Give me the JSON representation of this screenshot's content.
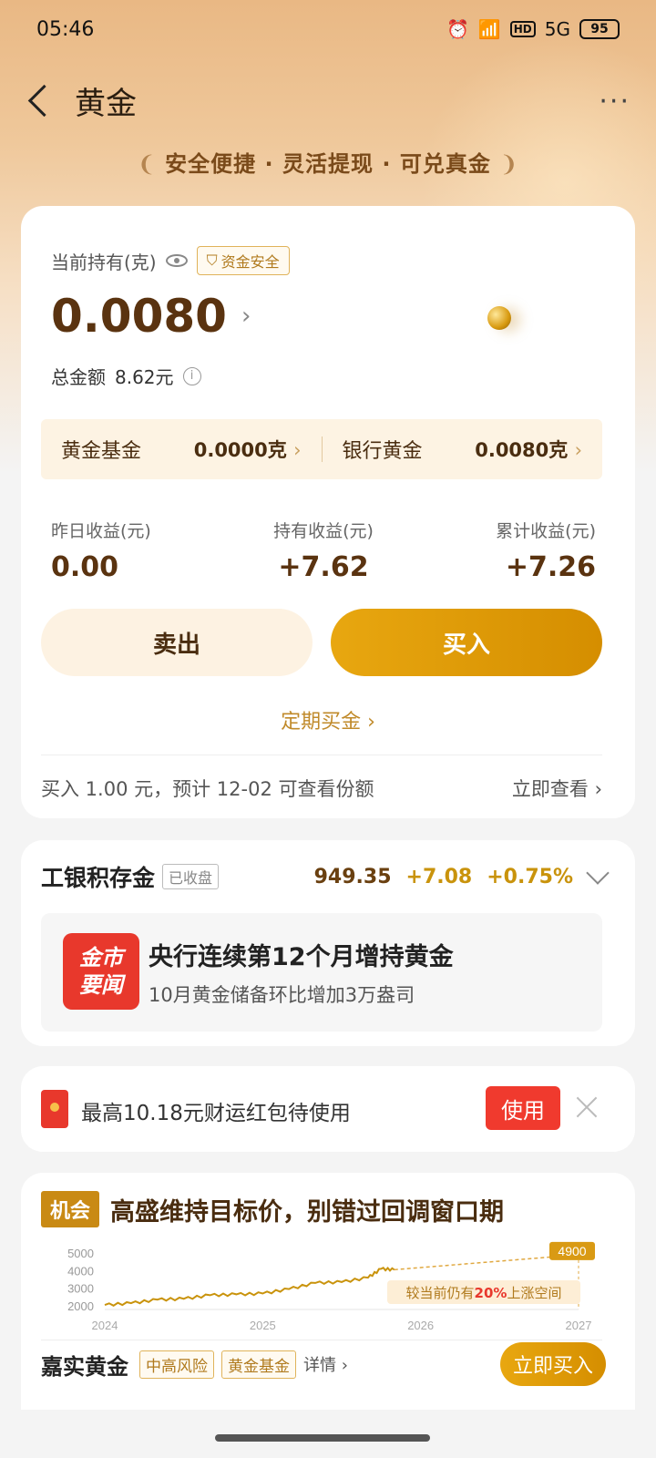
{
  "status_bar": {
    "time": "05:46",
    "battery": "95",
    "hd": "HD",
    "signal": "5G"
  },
  "header": {
    "title": "黄金",
    "more": "···"
  },
  "slogan": {
    "text": "安全便捷 · 灵活提现 · 可兑真金"
  },
  "holdings": {
    "label": "当前持有(克)",
    "safe_badge": "资金安全",
    "amount": "0.0080",
    "total_label": "总金额",
    "total_value": "8.62元",
    "split": [
      {
        "label": "黄金基金",
        "value": "0.0000克"
      },
      {
        "label": "银行黄金",
        "value": "0.0080克"
      }
    ],
    "earnings": [
      {
        "label": "昨日收益(元)",
        "value": "0.00"
      },
      {
        "label": "持有收益(元)",
        "value": "+7.62"
      },
      {
        "label": "累计收益(元)",
        "value": "+7.26"
      }
    ],
    "sell_label": "卖出",
    "buy_label": "买入",
    "periodic_label": "定期买金",
    "notice_text": "买入 1.00 元，预计 12-02 可查看份额",
    "notice_link": "立即查看"
  },
  "market": {
    "name": "工银积存金",
    "status": "已收盘",
    "price": "949.35",
    "change": "+7.08",
    "percent": "+0.75%",
    "news_logo_line1": "金市",
    "news_logo_line2": "要闻",
    "news_title": "央行连续第12个月增持黄金",
    "news_sub": "10月黄金储备环比增加3万盎司"
  },
  "redpack": {
    "text": "最高10.18元财运红包待使用",
    "use_label": "使用"
  },
  "opportunity": {
    "tag": "机会",
    "title": "高盛维持目标价，别错过回调窗口期",
    "fund_name": "嘉实黄金",
    "badge_risk": "中高风险",
    "badge_type": "黄金基金",
    "detail": "详情",
    "buy_now": "立即买入"
  },
  "chart_data": {
    "type": "line",
    "x_ticks": [
      "2024",
      "2025",
      "2026",
      "2027"
    ],
    "y_ticks": [
      "5000",
      "4000",
      "3000",
      "2000"
    ],
    "ylim": [
      2000,
      5000
    ],
    "series": [
      {
        "values": [
          [
            "2024-01",
            2050
          ],
          [
            "2024-03",
            2150
          ],
          [
            "2024-05",
            2350
          ],
          [
            "2024-07",
            2400
          ],
          [
            "2024-09",
            2600
          ],
          [
            "2024-11",
            2650
          ],
          [
            "2025-01",
            2700
          ],
          [
            "2025-03",
            2950
          ],
          [
            "2025-05",
            3300
          ],
          [
            "2025-07",
            3350
          ],
          [
            "2025-09",
            3600
          ],
          [
            "2025-10",
            4100
          ],
          [
            "2025-11",
            4050
          ]
        ]
      },
      {
        "values": [
          [
            "2025-11",
            4050
          ],
          [
            "2027-01",
            4900
          ]
        ]
      }
    ],
    "target_label": "4900",
    "annotation": {
      "prefix": "较当前仍有",
      "highlight": "20%",
      "suffix": "上涨空间"
    }
  },
  "colors": {
    "gold": "#c9930c",
    "brown": "#5a3310",
    "red": "#f03a2e"
  }
}
